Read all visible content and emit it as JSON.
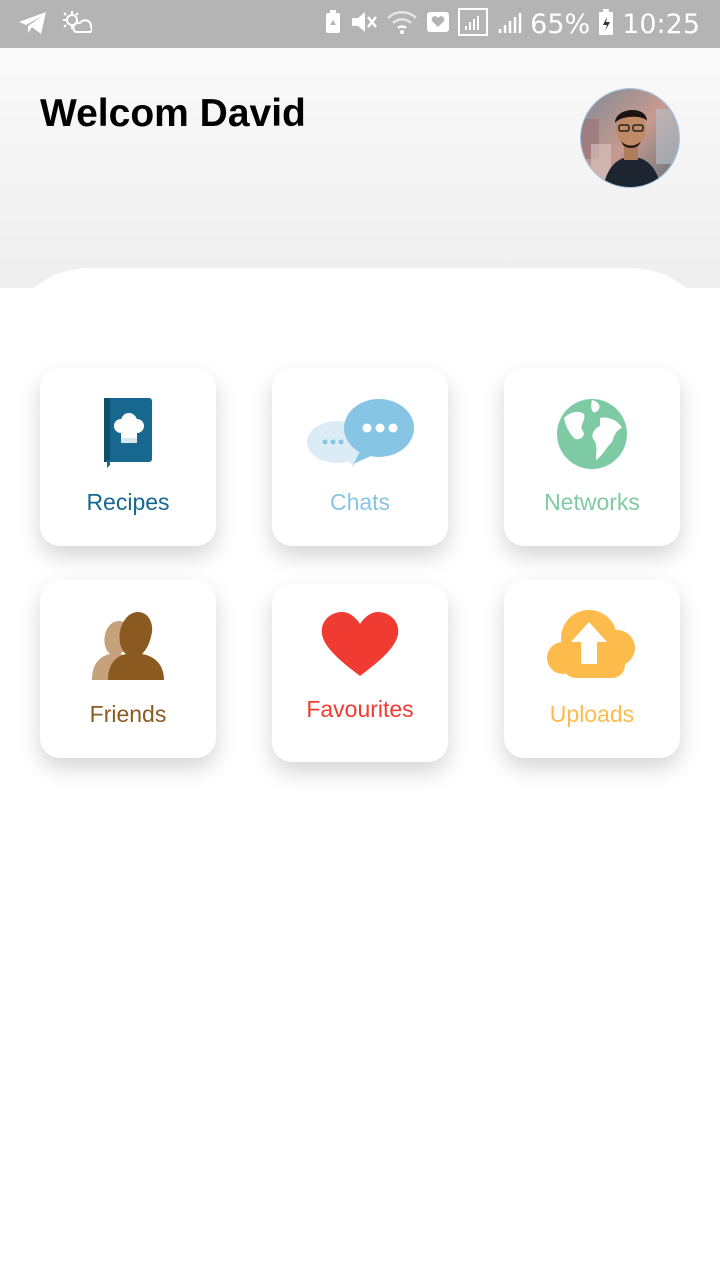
{
  "status_bar": {
    "battery": "65%",
    "time": "10:25",
    "icons": [
      "telegram-icon",
      "weather-icon",
      "battery-saver-icon",
      "mute-icon",
      "wifi-icon",
      "health-icon",
      "signal-icon",
      "signal-icon",
      "battery-icon"
    ]
  },
  "header": {
    "title": "Welcom David",
    "avatar_icon": "profile-photo"
  },
  "tiles": [
    {
      "label": "Recipes",
      "icon": "recipe-book-icon",
      "color": "#17678e"
    },
    {
      "label": "Chats",
      "icon": "chat-bubbles-icon",
      "color": "#86c5e3"
    },
    {
      "label": "Networks",
      "icon": "globe-icon",
      "color": "#7ecaa4"
    },
    {
      "label": "Friends",
      "icon": "friends-icon",
      "color": "#8a5a21"
    },
    {
      "label": "Favourites",
      "icon": "heart-icon",
      "color": "#f03b32"
    },
    {
      "label": "Uploads",
      "icon": "cloud-upload-icon",
      "color": "#fdbb4c"
    }
  ],
  "colors": {
    "status_bar": "#b4b4b4",
    "header_top": "#fafafa",
    "header_bottom": "#eeeeee"
  }
}
